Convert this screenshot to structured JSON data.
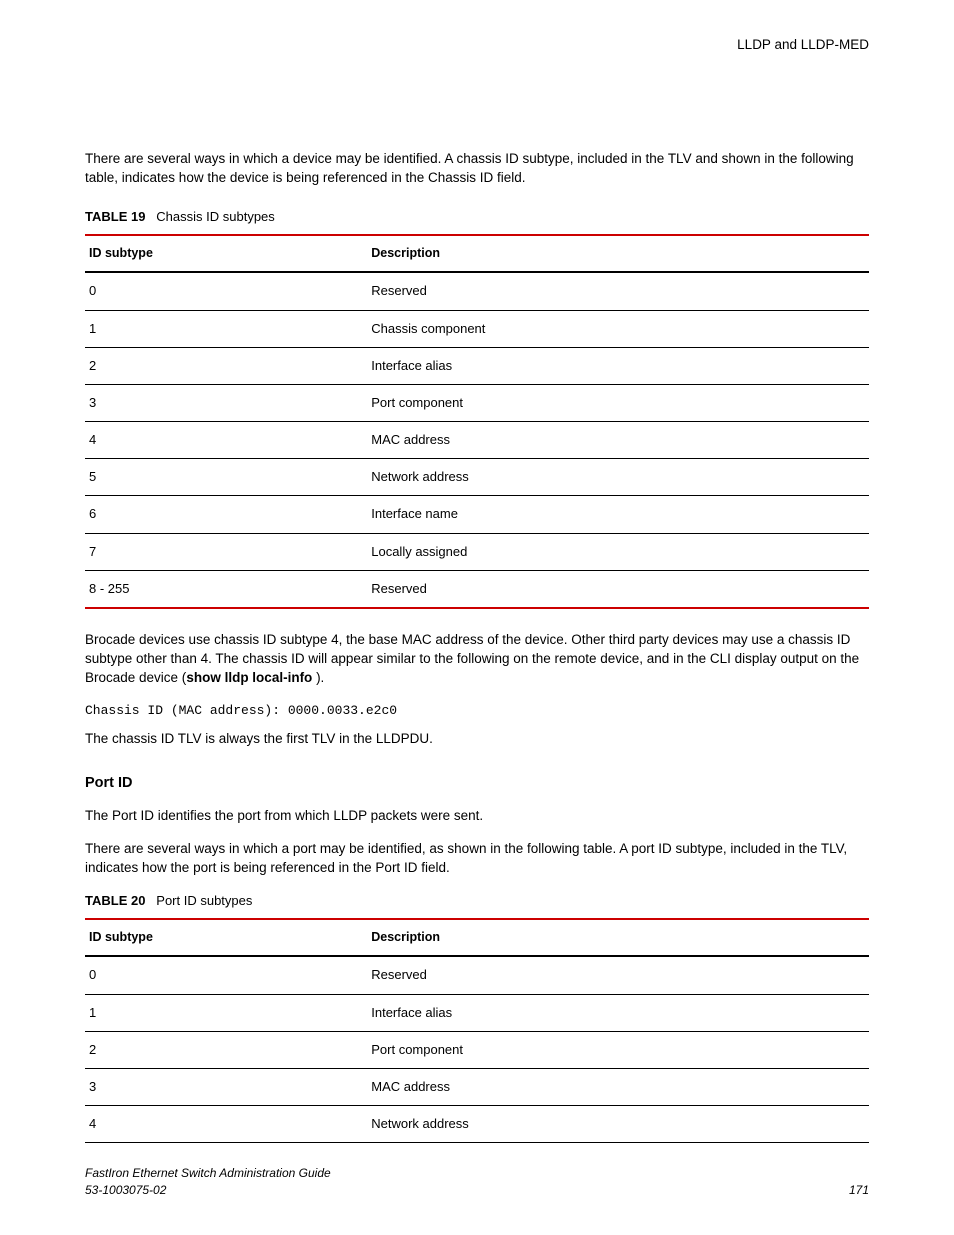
{
  "header": {
    "right": "LLDP and LLDP-MED"
  },
  "intro": "There are several ways in which a device may be identified. A chassis ID subtype, included in the TLV and shown in the following table, indicates how the device is being referenced in the Chassis ID field.",
  "table19": {
    "label": "TABLE 19",
    "caption": "Chassis ID subtypes",
    "headers": [
      "ID subtype",
      "Description"
    ],
    "rows": [
      [
        "0",
        "Reserved"
      ],
      [
        "1",
        "Chassis component"
      ],
      [
        "2",
        "Interface alias"
      ],
      [
        "3",
        "Port component"
      ],
      [
        "4",
        "MAC address"
      ],
      [
        "5",
        "Network address"
      ],
      [
        "6",
        "Interface name"
      ],
      [
        "7",
        "Locally assigned"
      ],
      [
        "8 - 255",
        "Reserved"
      ]
    ]
  },
  "post_table19": {
    "p1a": "Brocade devices use chassis ID subtype 4, the base MAC address of the device. Other third party devices may use a chassis ID subtype other than 4. The chassis ID will appear similar to the following on the remote device, and in the CLI display output on the Brocade device (",
    "cmd": "show lldp local-info",
    "p1b": " ).",
    "code": "Chassis ID (MAC address):  0000.0033.e2c0",
    "p2": "The chassis ID TLV is always the first TLV in the LLDPDU."
  },
  "section2": {
    "heading": "Port ID",
    "p1": "The Port ID identifies the port from which LLDP packets were sent.",
    "p2": "There are several ways in which a port may be identified, as shown in the following table. A port ID subtype, included in the TLV, indicates how the port is being referenced in the Port ID field."
  },
  "table20": {
    "label": "TABLE 20",
    "caption": "Port ID subtypes",
    "headers": [
      "ID subtype",
      "Description"
    ],
    "rows": [
      [
        "0",
        "Reserved"
      ],
      [
        "1",
        "Interface alias"
      ],
      [
        "2",
        "Port component"
      ],
      [
        "3",
        "MAC address"
      ],
      [
        "4",
        "Network address"
      ]
    ]
  },
  "footer": {
    "title": "FastIron Ethernet Switch Administration Guide",
    "doc": "53-1003075-02",
    "page": "171"
  }
}
